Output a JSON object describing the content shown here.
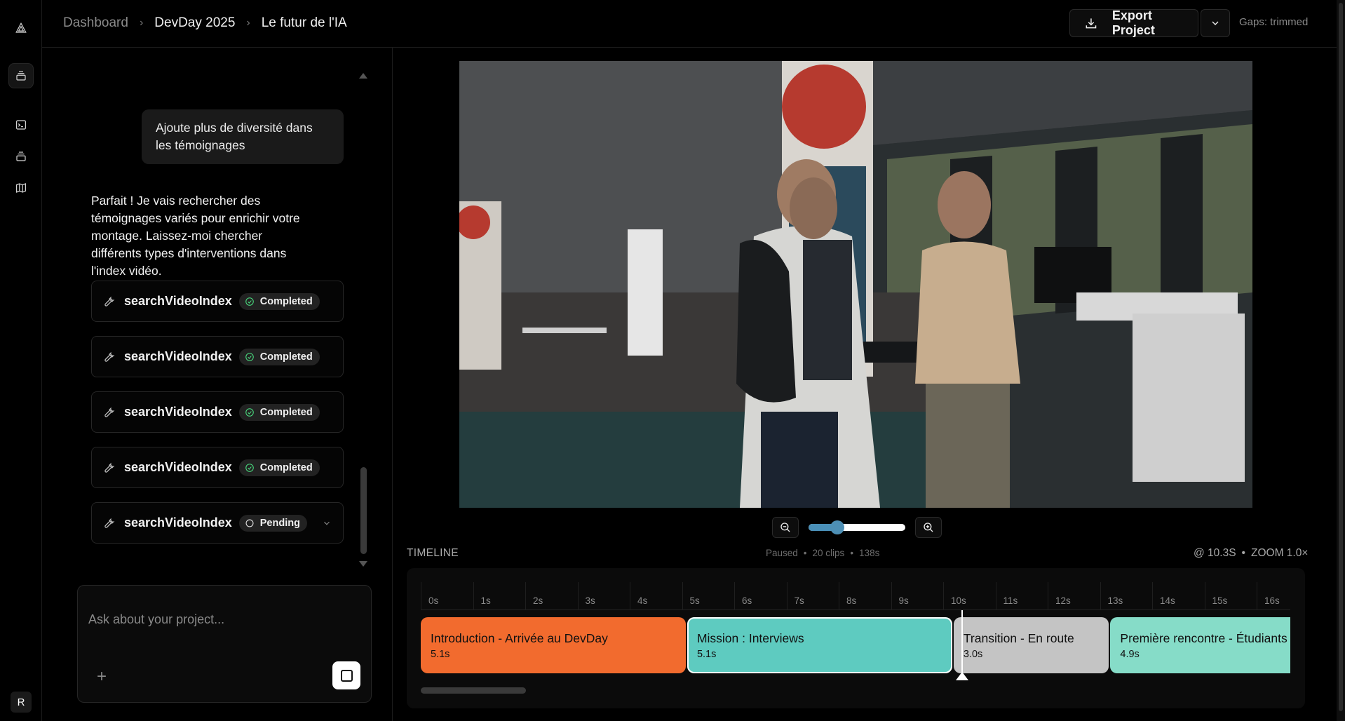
{
  "breadcrumb": {
    "items": [
      "Dashboard",
      "DevDay 2025",
      "Le futur de l'IA"
    ]
  },
  "header": {
    "export_label": "Export Project",
    "gaps_status": "Gaps: trimmed"
  },
  "rail": {
    "avatar": "R",
    "icons": [
      "logo-icon",
      "layers-icon",
      "terminal-icon",
      "stack-icon",
      "map-icon"
    ]
  },
  "chat": {
    "user_message": "Ajoute plus de diversité dans les témoignages",
    "assistant_message": "Parfait ! Je vais rechercher des témoignages variés pour enrichir votre montage. Laissez-moi chercher différents types d'interventions dans l'index vidéo.",
    "tool_calls": [
      {
        "name": "searchVideoIndex",
        "status": "Completed"
      },
      {
        "name": "searchVideoIndex",
        "status": "Completed"
      },
      {
        "name": "searchVideoIndex",
        "status": "Completed"
      },
      {
        "name": "searchVideoIndex",
        "status": "Completed"
      },
      {
        "name": "searchVideoIndex",
        "status": "Pending"
      }
    ],
    "input_placeholder": "Ask about your project..."
  },
  "player": {
    "zoom_level": 0.3
  },
  "timeline": {
    "label": "TIMELINE",
    "state": "Paused",
    "clips_count": "20 clips",
    "total_duration": "138s",
    "position": "@ 10.3S",
    "zoom": "ZOOM 1.0×",
    "ticks": [
      "0s",
      "1s",
      "2s",
      "3s",
      "4s",
      "5s",
      "6s",
      "7s",
      "8s",
      "9s",
      "10s",
      "11s",
      "12s",
      "13s",
      "14s",
      "15s",
      "16s"
    ],
    "clips": [
      {
        "title": "Introduction - Arrivée au DevDay",
        "duration": "5.1s",
        "color": "#f26b2e"
      },
      {
        "title": "Mission : Interviews",
        "duration": "5.1s",
        "color": "#5ecbc0"
      },
      {
        "title": "Transition - En route",
        "duration": "3.0s",
        "color": "#c4c4c4"
      },
      {
        "title": "Première rencontre - Étudiants",
        "duration": "4.9s",
        "color": "#86dcc8"
      }
    ]
  },
  "colors": {
    "completed": "#4ade80",
    "accent": "#4d8fb5"
  }
}
